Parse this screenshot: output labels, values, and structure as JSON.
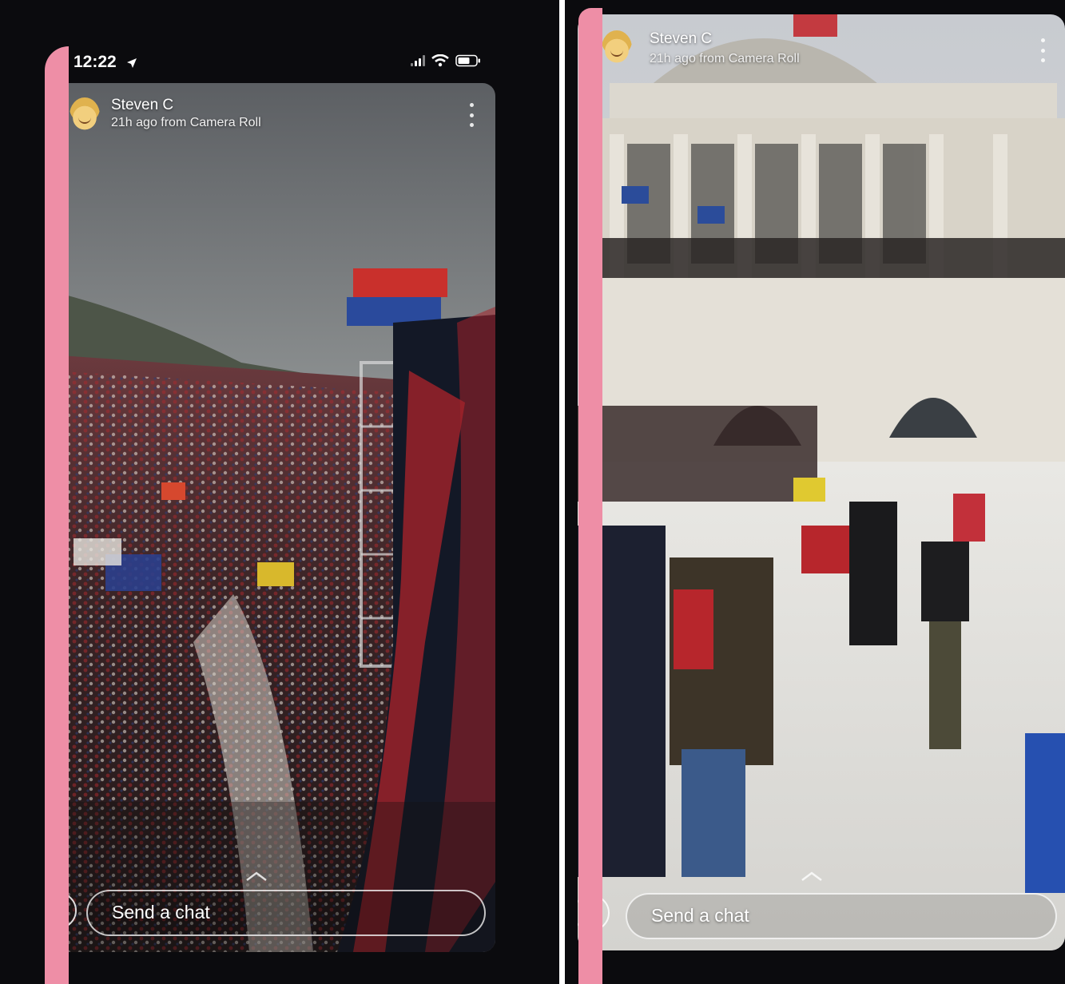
{
  "status_bar": {
    "time": "12:22"
  },
  "left_story": {
    "username": "Steven C",
    "subtitle": "21h ago from Camera Roll",
    "chat_placeholder": "Send a chat"
  },
  "right_story": {
    "username": "Steven C",
    "subtitle": "21h ago from Camera Roll",
    "chat_placeholder": "Send a chat"
  },
  "colors": {
    "phone_frame": "#0b0b0e",
    "pink_edge": "#ee8ea6",
    "crowd_red": "#b3262c",
    "flag_blue": "#2a4a9c"
  },
  "icons": [
    "location-arrow-icon",
    "signal-icon",
    "wifi-icon",
    "battery-icon",
    "more-icon",
    "camera-icon",
    "chevron-up-icon"
  ]
}
